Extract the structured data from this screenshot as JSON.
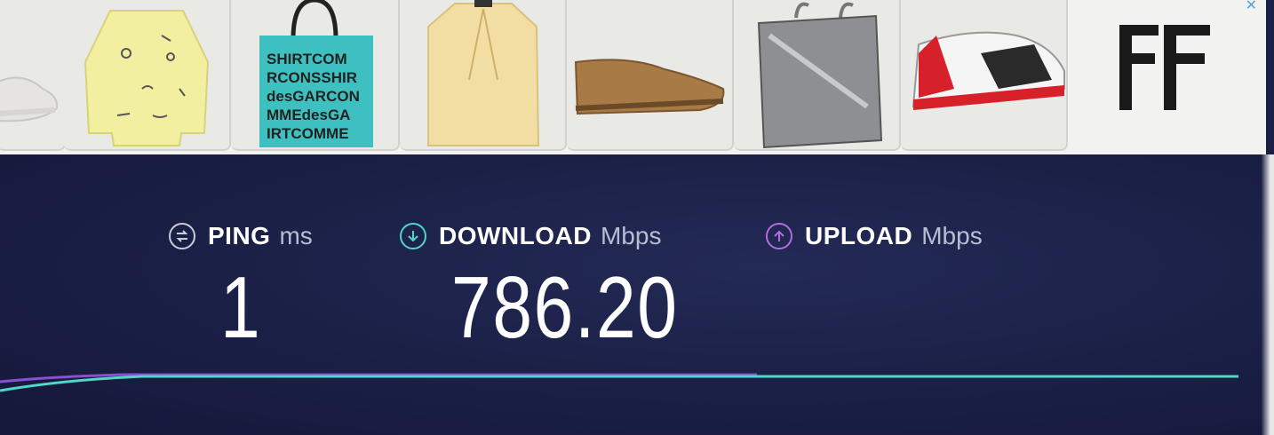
{
  "ad_banner": {
    "close_icon": "close-icon",
    "products": [
      {
        "name": "sneaker-white",
        "icon": "sneaker"
      },
      {
        "name": "shirt-yellow-print",
        "icon": "shirt"
      },
      {
        "name": "tote-bag-print",
        "icon": "tote-bag",
        "print_lines": [
          "SHIRTCOM",
          "RCONSSHIR",
          "desGARCON",
          "MMEdesGA",
          "IRTCOMME"
        ]
      },
      {
        "name": "blazer-yellow",
        "icon": "blazer"
      },
      {
        "name": "leather-shoe-brown",
        "icon": "shoe"
      },
      {
        "name": "bag-metallic",
        "icon": "bag"
      },
      {
        "name": "sneaker-red-white",
        "icon": "sneaker"
      }
    ],
    "brand_logo": "FF"
  },
  "speedtest": {
    "ping": {
      "label": "PING",
      "unit": "ms",
      "value": "1",
      "icon": "ping-icon",
      "color": "#c9ccd9"
    },
    "download": {
      "label": "DOWNLOAD",
      "unit": "Mbps",
      "value": "786.20",
      "icon": "download-icon",
      "color": "#4fd6c8"
    },
    "upload": {
      "label": "UPLOAD",
      "unit": "Mbps",
      "value": "",
      "icon": "upload-icon",
      "color": "#b36be0"
    },
    "graph": {
      "download_color": "#4fd6c8",
      "upload_color": "#8a4fd0"
    }
  }
}
